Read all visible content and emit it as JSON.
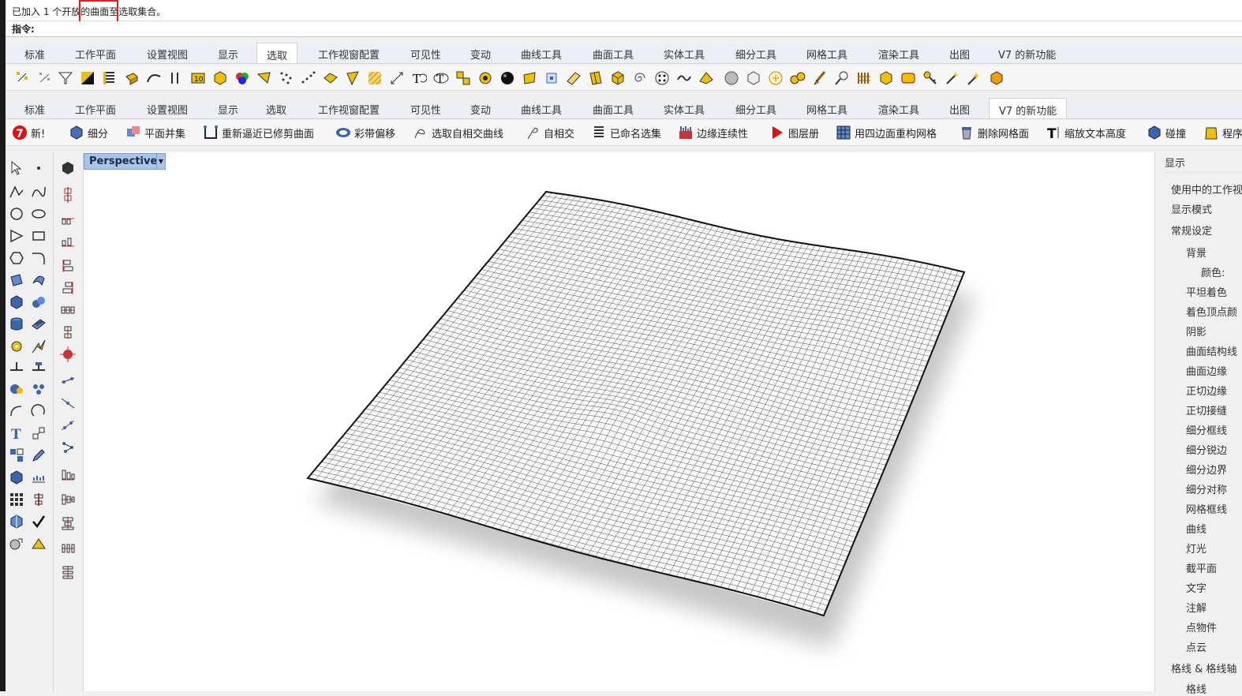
{
  "status": {
    "message": "已加入 1 个开放的曲面至选取集合。"
  },
  "command": {
    "label": "指令:"
  },
  "tabs": [
    "标准",
    "工作平面",
    "设置视图",
    "显示",
    "选取",
    "工作视窗配置",
    "可见性",
    "变动",
    "曲线工具",
    "曲面工具",
    "实体工具",
    "细分工具",
    "网格工具",
    "渲染工具",
    "出图",
    "V7 的新功能"
  ],
  "active_tab_top": "选取",
  "active_tab_bottom": "V7 的新功能",
  "new_features": {
    "new": "新!",
    "subdivide": "细分",
    "planar_union": "平面并集",
    "rebuild_untrimmed": "重新逼近已修剪曲面",
    "ribbon_offset": "彩带偏移",
    "select_self_intersect": "选取自相交曲线",
    "self_intersect": "自相交",
    "named_selections": "已命名选集",
    "edge_continuity": "边缘连续性",
    "layer_book": "图层册",
    "quad_remesh": "用四边面重构网格",
    "delete_mesh_faces": "删除网格面",
    "scale_text_height": "缩放文本高度",
    "collision": "碰撞",
    "procedural": "程序"
  },
  "viewport": {
    "name": "Perspective"
  },
  "display_panel": {
    "title": "显示",
    "items": [
      "使用中的工作视",
      "显示模式",
      "常规设定",
      "背景",
      "颜色:",
      "平坦着色",
      "着色顶点颜",
      "阴影",
      "曲面结构线",
      "曲面边缘",
      "正切边缘",
      "正切接缝",
      "细分框线",
      "细分锐边",
      "细分边界",
      "细分对称",
      "网格框线",
      "曲线",
      "灯光",
      "截平面",
      "文字",
      "注解",
      "点物件",
      "点云",
      "格线 & 格线轴",
      "格线"
    ]
  },
  "colors": {
    "accent": "#a9c4ea",
    "highlight": "#e0201a"
  }
}
